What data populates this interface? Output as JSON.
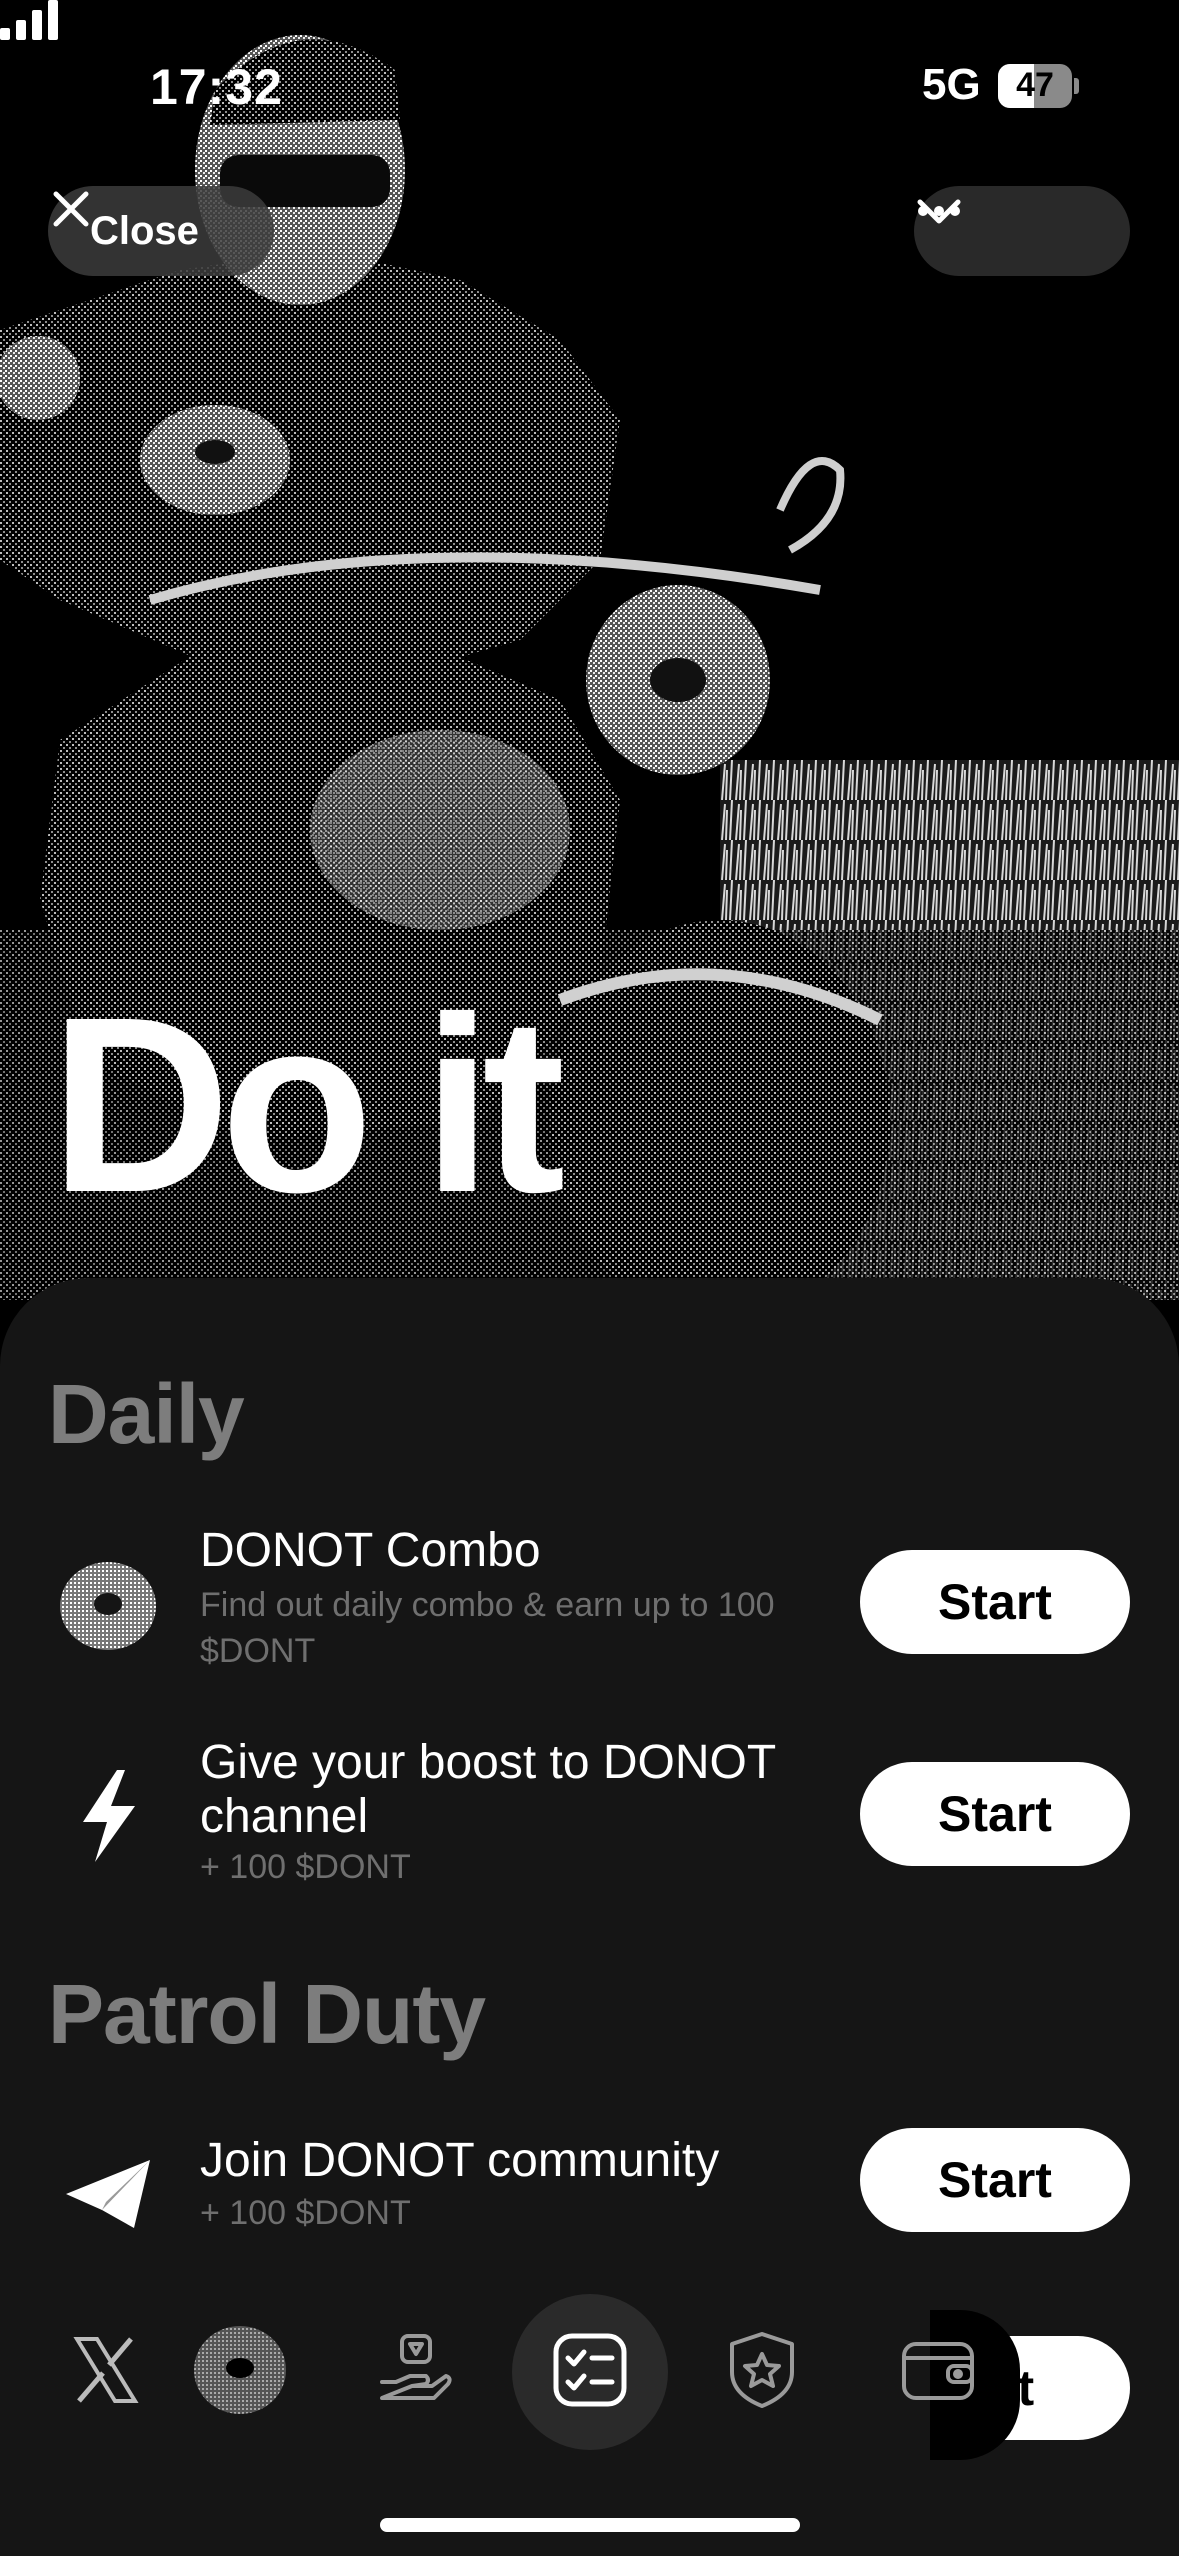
{
  "status": {
    "time": "17:32",
    "network": "5G",
    "battery": "47"
  },
  "header": {
    "close_label": "Close",
    "collapse_icon": "chevron-down-icon",
    "more_icon": "more-dots-icon"
  },
  "hero": {
    "title": "Do it"
  },
  "sections": [
    {
      "title": "Daily"
    },
    {
      "title": "Patrol Duty"
    }
  ],
  "tasks": [
    {
      "title": "DONOT Combo",
      "subtitle": "Find out daily combo & earn up to 100 $DONT",
      "button": "Start",
      "icon": "donut-icon"
    },
    {
      "title": "Give your boost to DONOT channel",
      "subtitle": "+ 100 $DONT",
      "button": "Start",
      "icon": "lightning-icon"
    },
    {
      "title": "Join DONOT community",
      "subtitle": "+ 100 $DONT",
      "button": "Start",
      "icon": "telegram-icon"
    }
  ],
  "nav": {
    "items": [
      "x-icon",
      "donut-icon",
      "hand-coin-icon",
      "tasks-checklist-icon",
      "badge-star-icon",
      "wallet-icon"
    ],
    "peek_label": "rt"
  }
}
